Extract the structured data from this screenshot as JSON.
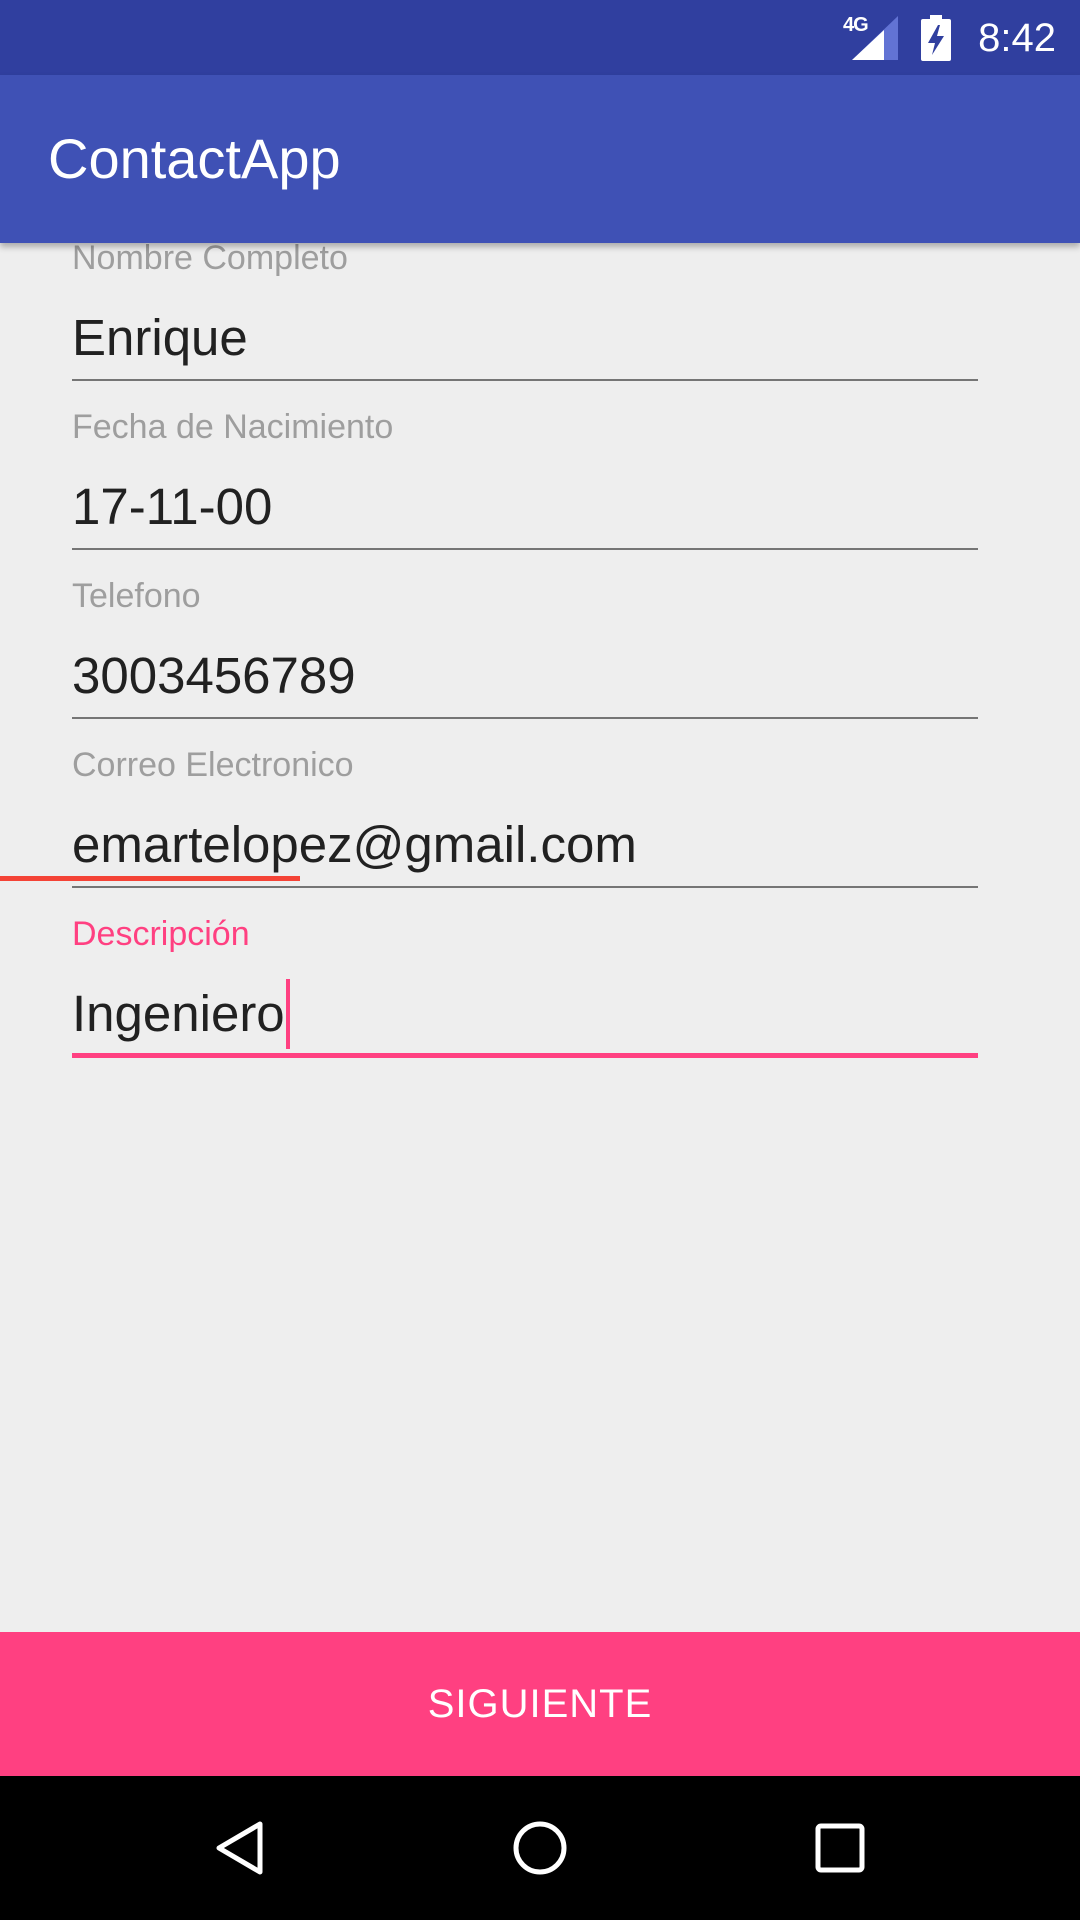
{
  "status_bar": {
    "network": "4G",
    "time": "8:42"
  },
  "app_bar": {
    "title": "ContactApp"
  },
  "form": {
    "fields": [
      {
        "label": "Nombre Completo",
        "value": "Enrique"
      },
      {
        "label": "Fecha de Nacimiento",
        "value": "17-11-00"
      },
      {
        "label": "Telefono",
        "value": "3003456789"
      },
      {
        "label": "Correo Electronico",
        "value": "emartelopez@gmail.com"
      },
      {
        "label": "Descripción",
        "value": "Ingeniero",
        "focused": true
      }
    ]
  },
  "actions": {
    "next_label": "SIGUIENTE"
  },
  "colors": {
    "primary_dark": "#303f9f",
    "primary": "#3f51b5",
    "accent": "#ff4081",
    "spell_error": "#f44336"
  },
  "icons": {
    "nav_back": "back-triangle-icon",
    "nav_home": "home-circle-icon",
    "nav_recents": "recents-square-icon",
    "signal": "cell-signal-icon",
    "battery": "battery-charging-icon"
  }
}
